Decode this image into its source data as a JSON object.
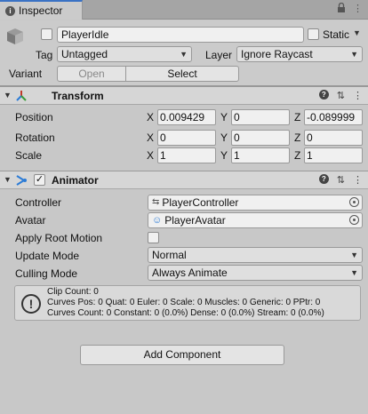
{
  "tab": {
    "label": "Inspector"
  },
  "header": {
    "object_name": "PlayerIdle",
    "static_label": "Static",
    "tag_label": "Tag",
    "tag_value": "Untagged",
    "layer_label": "Layer",
    "layer_value": "Ignore Raycast",
    "variant_label": "Variant",
    "open_label": "Open",
    "select_label": "Select"
  },
  "transform": {
    "title": "Transform",
    "rows": [
      {
        "label": "Position",
        "x": "0.009429",
        "y": "0",
        "z": "-0.089999"
      },
      {
        "label": "Rotation",
        "x": "0",
        "y": "0",
        "z": "0"
      },
      {
        "label": "Scale",
        "x": "1",
        "y": "1",
        "z": "1"
      }
    ],
    "axes": {
      "x": "X",
      "y": "Y",
      "z": "Z"
    }
  },
  "animator": {
    "title": "Animator",
    "controller_label": "Controller",
    "controller_value": "PlayerController",
    "avatar_label": "Avatar",
    "avatar_value": "PlayerAvatar",
    "apply_root_motion_label": "Apply Root Motion",
    "update_mode_label": "Update Mode",
    "update_mode_value": "Normal",
    "culling_mode_label": "Culling Mode",
    "culling_mode_value": "Always Animate",
    "info_lines": [
      "Clip Count: 0",
      "Curves Pos: 0 Quat: 0 Euler: 0 Scale: 0 Muscles: 0 Generic: 0 PPtr: 0",
      "Curves Count: 0 Constant: 0 (0.0%) Dense: 0 (0.0%) Stream: 0 (0.0%)"
    ]
  },
  "add_component_label": "Add Component",
  "colors": {
    "tab_accent": "#3a72c4",
    "background": "#c8c8c8",
    "transform_icon": "#c0392b",
    "animator_icon": "#2b7bd6"
  }
}
